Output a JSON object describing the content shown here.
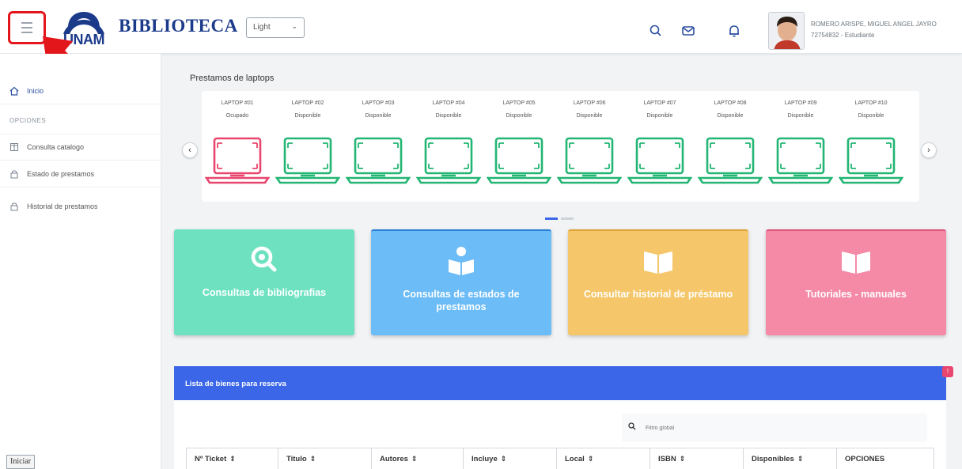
{
  "header": {
    "brand": "BIBLIOTECA",
    "logo_text": "UNAM",
    "theme_select": "Light",
    "user_name": "ROMERO ARISPE, MIGUEL ANGEL JAYRO",
    "user_id": "72754832 - Estudiante",
    "icons": [
      "hamburger-icon",
      "search-icon",
      "mail-icon",
      "bell-icon"
    ]
  },
  "sidebar": {
    "items": [
      {
        "label": "Inicio",
        "icon": "home-icon"
      },
      {
        "label": "Consulta catalogo",
        "icon": "book-icon"
      },
      {
        "label": "Estado de prestamos",
        "icon": "lock-icon"
      },
      {
        "label": "Historial de prestamos",
        "icon": "lock-icon"
      }
    ],
    "section_heading": "OPCIONES",
    "iniciar_label": "Iniciar"
  },
  "laptops": {
    "title": "Prestamos de laptops",
    "items": [
      {
        "label": "LAPTOP #01",
        "status": "Ocupado"
      },
      {
        "label": "LAPTOP #02",
        "status": "Disponible"
      },
      {
        "label": "LAPTOP #03",
        "status": "Disponible"
      },
      {
        "label": "LAPTOP #04",
        "status": "Disponible"
      },
      {
        "label": "LAPTOP #05",
        "status": "Disponible"
      },
      {
        "label": "LAPTOP #06",
        "status": "Disponible"
      },
      {
        "label": "LAPTOP #07",
        "status": "Disponible"
      },
      {
        "label": "LAPTOP #08",
        "status": "Disponible"
      },
      {
        "label": "LAPTOP #09",
        "status": "Disponible"
      },
      {
        "label": "LAPTOP #10",
        "status": "Disponible"
      }
    ],
    "colors": {
      "occupied": "#e8466e",
      "available": "#22b573"
    }
  },
  "cards": [
    {
      "title": "Consultas de bibliografias",
      "color": "#6ee2c0",
      "icon": "search-icon"
    },
    {
      "title": "Consultas de estados de prestamos",
      "color": "#6cbcf7",
      "icon": "reader-icon"
    },
    {
      "title": "Consultar historial de préstamo",
      "color": "#f5c76a",
      "icon": "open-book-icon"
    },
    {
      "title": "Tutoriales - manuales",
      "color": "#f48aa6",
      "icon": "open-book-icon"
    }
  ],
  "reserve_panel": {
    "title": "Lista de bienes para reserva",
    "badge": "!",
    "search_placeholder": "Filtro global",
    "columns": [
      "Nº Ticket",
      "Titulo",
      "Autores",
      "Incluye",
      "Local",
      "ISBN",
      "Disponibles",
      "OPCIONES"
    ]
  },
  "accent_color": "#3b66e8"
}
